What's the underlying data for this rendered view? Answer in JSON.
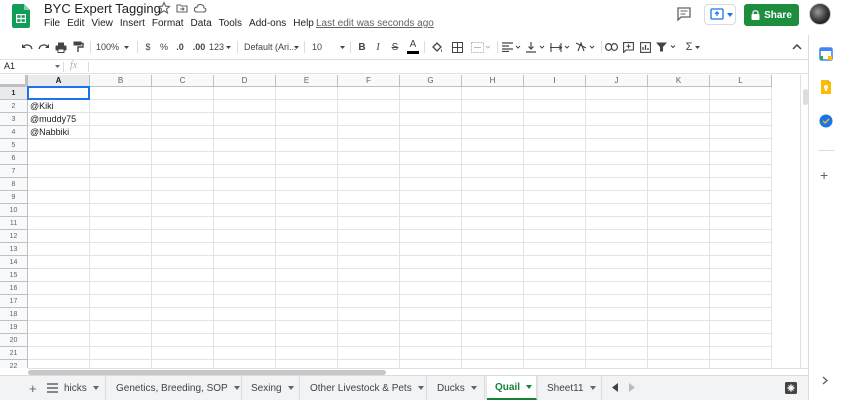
{
  "app": {
    "doc_title": "BYC Expert Tagging",
    "menus": [
      "File",
      "Edit",
      "View",
      "Insert",
      "Format",
      "Data",
      "Tools",
      "Add-ons",
      "Help"
    ],
    "last_edit": "Last edit was seconds ago",
    "share_label": "Share",
    "brand_color": "#1e8e3e"
  },
  "toolbar": {
    "zoom": "100%",
    "currency": "$",
    "percent": "%",
    "decrease_decimal": ".0",
    "increase_decimal": ".00",
    "more_formats": "123",
    "font_family": "Default (Ari...",
    "font_size": "10",
    "bold": "B",
    "italic": "I",
    "strikethrough": "S",
    "text_color": "A",
    "sum": "Σ"
  },
  "formula_bar": {
    "name_box": "A1",
    "fx": "fx",
    "value": ""
  },
  "grid": {
    "columns": [
      "A",
      "B",
      "C",
      "D",
      "E",
      "F",
      "G",
      "H",
      "I",
      "J",
      "K",
      "L"
    ],
    "rows": [
      "1",
      "2",
      "3",
      "4",
      "5",
      "6",
      "7",
      "8",
      "9",
      "10",
      "11",
      "12",
      "13",
      "14",
      "15",
      "16",
      "17",
      "18",
      "19",
      "20",
      "21",
      "22"
    ],
    "active_cell": "A1",
    "cells": {
      "A2": "@Kiki",
      "A3": "@muddy75",
      "A4": "@Nabbiki"
    }
  },
  "sheet_tabs": {
    "add": "+",
    "tabs": [
      {
        "label": "hicks",
        "active": false
      },
      {
        "label": "Genetics, Breeding, SOP",
        "active": false
      },
      {
        "label": "Sexing",
        "active": false
      },
      {
        "label": "Other Livestock & Pets",
        "active": false
      },
      {
        "label": "Ducks",
        "active": false
      },
      {
        "label": "Quail",
        "active": true
      },
      {
        "label": "Sheet11",
        "active": false
      }
    ]
  },
  "side_panel": {
    "icons": [
      "calendar-icon",
      "keep-icon",
      "tasks-icon"
    ],
    "add": "+"
  }
}
